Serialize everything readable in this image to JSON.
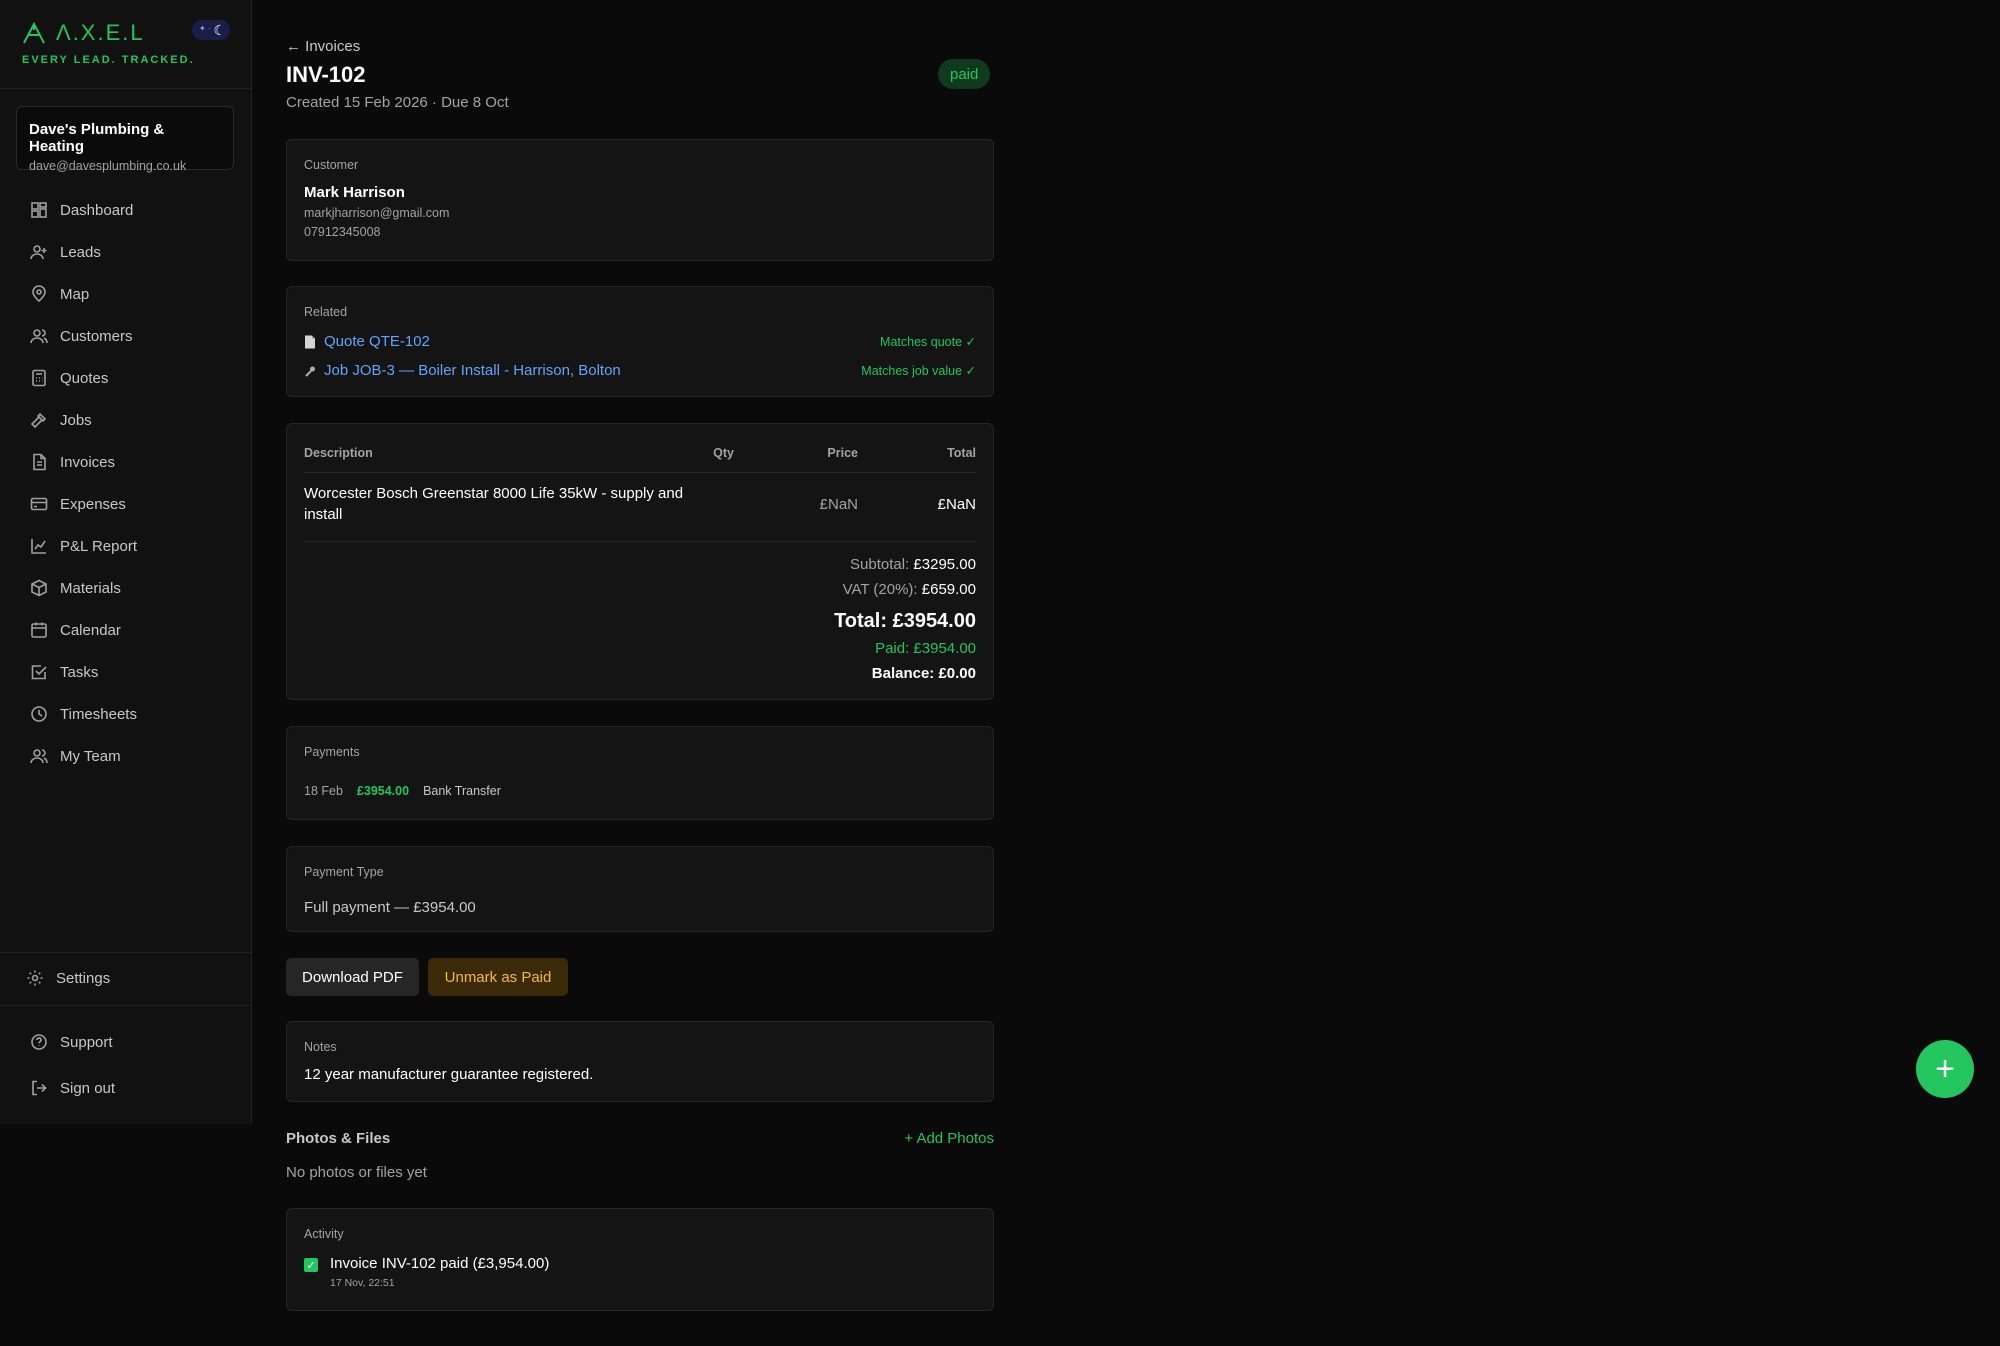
{
  "brand": {
    "name": "Λ.X.E.L",
    "tagline": "EVERY LEAD. TRACKED."
  },
  "account": {
    "business_name": "Dave's Plumbing & Heating",
    "email": "dave@davesplumbing.co.uk"
  },
  "sidebar": {
    "items": [
      {
        "label": "Dashboard",
        "icon": "grid-icon"
      },
      {
        "label": "Leads",
        "icon": "user-plus-icon"
      },
      {
        "label": "Map",
        "icon": "map-pin-icon"
      },
      {
        "label": "Customers",
        "icon": "users-icon"
      },
      {
        "label": "Quotes",
        "icon": "calculator-icon"
      },
      {
        "label": "Jobs",
        "icon": "hammer-icon"
      },
      {
        "label": "Invoices",
        "icon": "file-text-icon"
      },
      {
        "label": "Expenses",
        "icon": "credit-card-icon"
      },
      {
        "label": "P&L Report",
        "icon": "line-chart-icon"
      },
      {
        "label": "Materials",
        "icon": "box-icon"
      },
      {
        "label": "Calendar",
        "icon": "calendar-icon"
      },
      {
        "label": "Tasks",
        "icon": "check-square-icon"
      },
      {
        "label": "Timesheets",
        "icon": "clock-icon"
      },
      {
        "label": "My Team",
        "icon": "users-icon"
      }
    ],
    "settings_label": "Settings",
    "support_label": "Support",
    "signout_label": "Sign out"
  },
  "header": {
    "back_label": "← Invoices",
    "title": "INV-102",
    "subtitle": "Created 15 Feb 2026 · Due 8 Oct",
    "status": "paid"
  },
  "customer": {
    "section_label": "Customer",
    "name": "Mark Harrison",
    "email": "markjharrison@gmail.com",
    "phone": "07912345008"
  },
  "related": {
    "section_label": "Related",
    "quote_link": "Quote QTE-102",
    "quote_match": "Matches quote ✓",
    "job_link": "Job JOB-3 — Boiler Install - Harrison, Bolton",
    "job_match": "Matches job value ✓"
  },
  "line_items": {
    "columns": [
      "Description",
      "Qty",
      "Price",
      "Total"
    ],
    "rows": [
      {
        "description": "Worcester Bosch Greenstar 8000 Life 35kW - supply and install",
        "qty": "",
        "price": "£NaN",
        "total": "£NaN"
      }
    ]
  },
  "totals": {
    "subtotal_label": "Subtotal:",
    "subtotal": "£3295.00",
    "vat_label": "VAT (20%):",
    "vat": "£659.00",
    "total": "Total: £3954.00",
    "paid": "Paid: £3954.00",
    "balance": "Balance: £0.00"
  },
  "payments": {
    "section_label": "Payments",
    "rows": [
      {
        "date": "18 Feb",
        "amount": "£3954.00",
        "method": "Bank Transfer"
      }
    ]
  },
  "payment_type": {
    "section_label": "Payment Type",
    "value": "Full payment — £3954.00"
  },
  "actions": {
    "download_pdf": "Download PDF",
    "unmark_paid": "Unmark as Paid"
  },
  "notes": {
    "section_label": "Notes",
    "text": "12 year manufacturer guarantee registered."
  },
  "photos": {
    "title": "Photos & Files",
    "add_label": "+ Add Photos",
    "empty": "No photos or files yet"
  },
  "activity": {
    "section_label": "Activity",
    "items": [
      {
        "text": "Invoice INV-102 paid (£3,954.00)",
        "time": "17 Nov, 22:51"
      }
    ]
  },
  "fab": {
    "label": "+"
  },
  "colors": {
    "accent": "#22c55e",
    "link": "#60a5fa",
    "warning": "#f5b93b",
    "background": "#0a0a0a"
  }
}
